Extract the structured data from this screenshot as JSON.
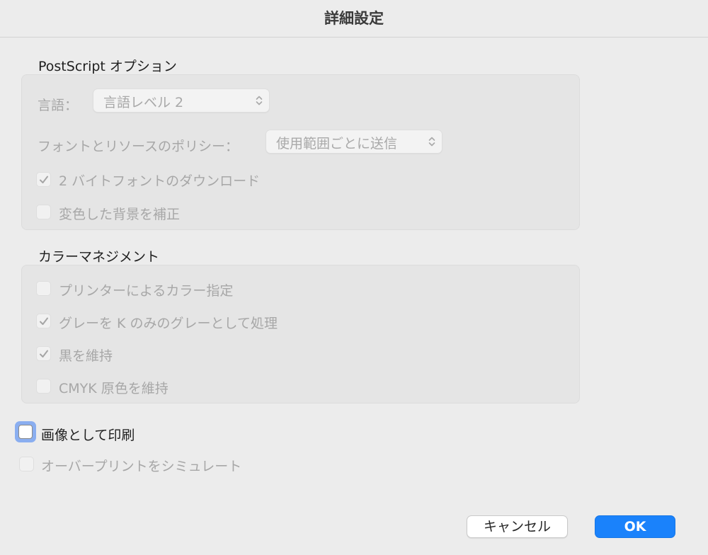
{
  "dialog": {
    "title": "詳細設定"
  },
  "postscript": {
    "section_title": "PostScript オプション",
    "language_label": "言語：",
    "language_value": "言語レベル 2",
    "font_policy_label": "フォントとリソースのポリシー：",
    "font_policy_value": "使用範囲ごとに送信",
    "download_2byte": {
      "label": "2 バイトフォントのダウンロード",
      "checked": true,
      "enabled": false
    },
    "correct_bg": {
      "label": "変色した背景を補正",
      "checked": false,
      "enabled": false
    }
  },
  "color_management": {
    "section_title": "カラーマネジメント",
    "printer_color": {
      "label": "プリンターによるカラー指定",
      "checked": false,
      "enabled": false
    },
    "gray_k_only": {
      "label": "グレーを K のみのグレーとして処理",
      "checked": true,
      "enabled": false
    },
    "keep_black": {
      "label": "黒を維持",
      "checked": true,
      "enabled": false
    },
    "keep_cmyk": {
      "label": "CMYK 原色を維持",
      "checked": false,
      "enabled": false
    }
  },
  "print_as_image": {
    "label": "画像として印刷",
    "checked": false,
    "enabled": true,
    "focused": true
  },
  "simulate_overprint": {
    "label": "オーバープリントをシミュレート",
    "checked": false,
    "enabled": false
  },
  "buttons": {
    "cancel": "キャンセル",
    "ok": "OK"
  },
  "colors": {
    "accent": "#1a82fb",
    "focus_ring": "#8aaef0",
    "disabled_text": "#a7a7a7"
  },
  "icons": {
    "checkmark": "checkmark-icon",
    "popup_chevron": "chevron-updown-icon"
  }
}
